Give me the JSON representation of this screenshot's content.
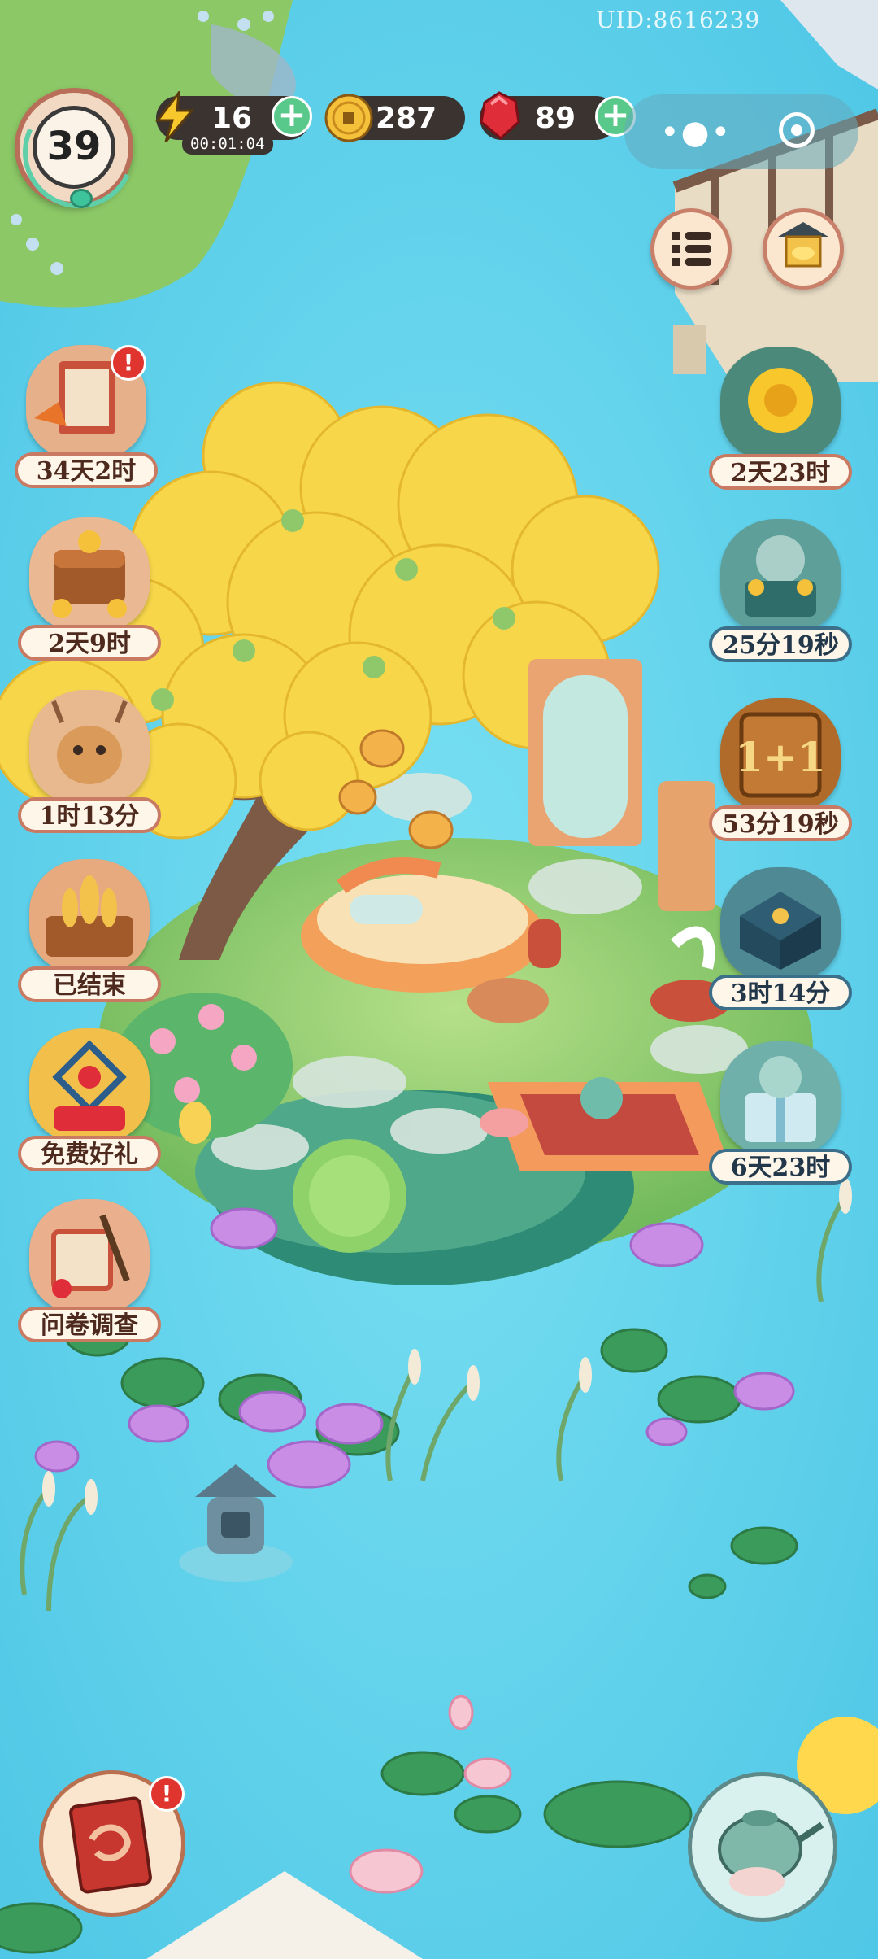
{
  "uid": "UID:8616239",
  "player": {
    "level": "39"
  },
  "energy": {
    "value": "16",
    "timer": "00:01:04"
  },
  "coins": {
    "value": "287"
  },
  "gems": {
    "value": "89"
  },
  "left_events": [
    {
      "name": "event-calendar",
      "timer": "34天2时",
      "badge": "!"
    },
    {
      "name": "event-treasure-chest",
      "timer": "2天9时"
    },
    {
      "name": "event-deer-spirit",
      "timer": "1时13分"
    },
    {
      "name": "event-wheat-harvest",
      "timer": "已结束"
    },
    {
      "name": "event-free-gift",
      "timer": "免费好礼"
    },
    {
      "name": "event-survey",
      "timer": "问卷调查"
    }
  ],
  "right_events": [
    {
      "name": "event-chrysanthemum",
      "timer": "2天23时"
    },
    {
      "name": "event-cat-chest",
      "timer": "25分19秒"
    },
    {
      "name": "event-one-plus-one",
      "timer": "53分19秒"
    },
    {
      "name": "event-jade-box",
      "timer": "3时14分"
    },
    {
      "name": "event-cat-gift",
      "timer": "6天23时"
    }
  ],
  "book_badge": "!",
  "colors": {
    "water": "#5fd3ec",
    "tree_yellow": "#f7d64a",
    "grass": "#8fcf6a",
    "label_border": "#c97a62"
  }
}
